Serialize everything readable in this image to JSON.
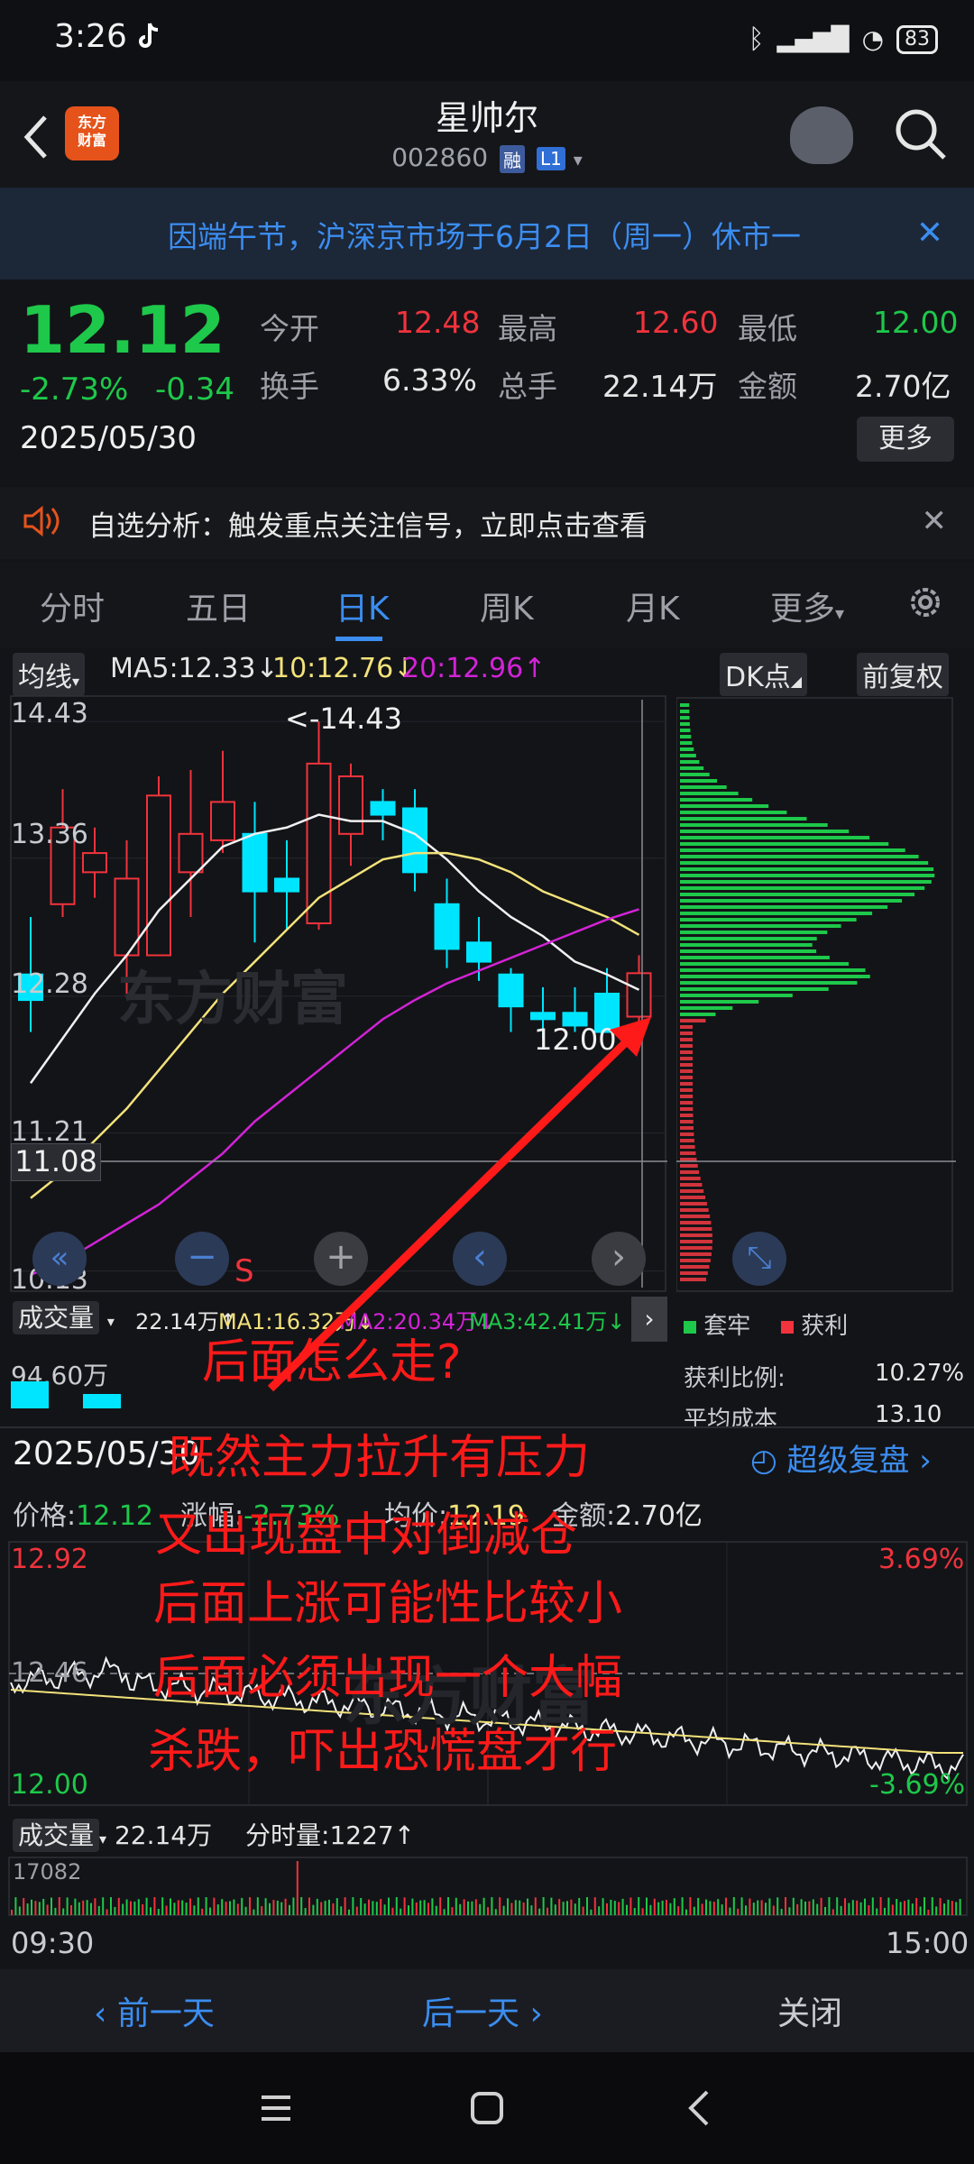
{
  "status_bar": {
    "time": "3:26",
    "battery": "83"
  },
  "header": {
    "name": "星帅尔",
    "code": "002860",
    "tags": [
      "融",
      "L1"
    ]
  },
  "banner": {
    "text": "因端午节，沪深京市场于6月2日（周一）休市一"
  },
  "quote": {
    "price": "12.12",
    "change_pct": "-2.73%",
    "change": "-0.34",
    "date": "2025/05/30",
    "open_label": "今开",
    "open": "12.48",
    "high_label": "最高",
    "high": "12.60",
    "low_label": "最低",
    "low": "12.00",
    "turnover_label": "换手",
    "turnover": "6.33%",
    "volume_label": "总手",
    "volume": "22.14万",
    "amount_label": "金额",
    "amount": "2.70亿",
    "more": "更多"
  },
  "notice": {
    "text": "自选分析：触发重点关注信号，立即点击查看"
  },
  "tabs": [
    "分时",
    "五日",
    "日K",
    "周K",
    "月K",
    "更多"
  ],
  "active_tab": 2,
  "kline": {
    "ma_selector": "均线",
    "ma5": "MA5:12.33",
    "ma10": "10:12.76",
    "ma20": "20:12.96",
    "dk": "DK点",
    "adjust": "前复权",
    "y_labels": [
      "14.43",
      "13.36",
      "12.28",
      "11.21",
      "10.13"
    ],
    "max_label": "<-14.43",
    "min_label": "12.00",
    "crosshair_label": "11.08",
    "s_marker": "S",
    "candles": [
      [
        12.45,
        12.25,
        12.9,
        12.0
      ],
      [
        13.0,
        13.6,
        13.9,
        12.9
      ],
      [
        13.25,
        13.4,
        13.6,
        13.05
      ],
      [
        12.6,
        13.2,
        13.5,
        12.3
      ],
      [
        12.6,
        13.85,
        14.0,
        12.6
      ],
      [
        13.25,
        13.55,
        14.05,
        12.9
      ],
      [
        13.5,
        13.8,
        14.2,
        13.4
      ],
      [
        13.55,
        13.1,
        13.8,
        12.7
      ],
      [
        13.2,
        13.1,
        13.5,
        12.8
      ],
      [
        12.85,
        14.1,
        14.43,
        12.8
      ],
      [
        13.55,
        14.0,
        14.1,
        13.3
      ],
      [
        13.8,
        13.7,
        13.9,
        13.5
      ],
      [
        13.75,
        13.25,
        13.9,
        13.1
      ],
      [
        13.0,
        12.65,
        13.2,
        12.5
      ],
      [
        12.7,
        12.55,
        12.9,
        12.4
      ],
      [
        12.45,
        12.2,
        12.5,
        12.0
      ],
      [
        12.15,
        12.1,
        12.35,
        11.95
      ],
      [
        12.15,
        12.05,
        12.35,
        12.0
      ],
      [
        12.3,
        12.0,
        12.5,
        12.0
      ],
      [
        12.12,
        12.46,
        12.6,
        12.0
      ]
    ],
    "ma5_line": [
      11.6,
      11.95,
      12.3,
      12.6,
      12.95,
      13.2,
      13.45,
      13.55,
      13.6,
      13.7,
      13.65,
      13.65,
      13.55,
      13.35,
      13.1,
      12.9,
      12.75,
      12.55,
      12.45,
      12.33
    ],
    "ma10_line": [
      10.7,
      10.9,
      11.15,
      11.4,
      11.7,
      12.0,
      12.3,
      12.55,
      12.8,
      13.05,
      13.2,
      13.35,
      13.4,
      13.4,
      13.35,
      13.25,
      13.1,
      13.0,
      12.9,
      12.76
    ],
    "ma20_line": [
      10.1,
      10.2,
      10.35,
      10.5,
      10.65,
      10.85,
      11.05,
      11.3,
      11.5,
      11.7,
      11.9,
      12.1,
      12.25,
      12.38,
      12.48,
      12.58,
      12.68,
      12.78,
      12.88,
      12.96
    ],
    "controls": [
      "«",
      "−",
      "+",
      "‹",
      "›",
      "⤡"
    ]
  },
  "chip": {
    "legend1": "套牢",
    "legend2": "获利",
    "ratio_label": "获利比例:",
    "ratio": "10.27%",
    "avg_label": "平均成本",
    "avg": "13.10"
  },
  "vol_bar": {
    "label": "成交量",
    "vol": "22.14万",
    "ma1": "MA1:16.32万",
    "ma2": "MA2:20.34万",
    "ma3": "MA3:42.41万",
    "y": "94.60万"
  },
  "annotations": [
    "后面怎么走?",
    "既然主力拉升有压力",
    "又出现盘中对倒减仓",
    "后面上涨可能性比较小",
    "后面必须出现一个大幅",
    "杀跌，吓出恐慌盘才行"
  ],
  "replay": {
    "date": "2025/05/30",
    "link": "超级复盘"
  },
  "intraday": {
    "price_label": "价格:",
    "price": "12.12",
    "change_label": "涨幅:",
    "change": "-2.73%",
    "avg_label": "均价:",
    "avg": "12.19",
    "amount_label": "金额:",
    "amount": "2.70亿",
    "hi": "12.92",
    "mid": "12.46",
    "lo": "12.00",
    "hi_pct": "3.69%",
    "lo_pct": "-3.69%",
    "vol_label": "成交量",
    "vol": "22.14万",
    "tick_label": "分时量:",
    "tick": "1227",
    "vol_max": "17082",
    "start": "09:30",
    "end": "15:00"
  },
  "bottom_nav": {
    "prev": "前一天",
    "next": "后一天",
    "close": "关闭"
  },
  "colors": {
    "up": "#f0333c",
    "down": "#00e5ff",
    "accent": "#3b8df0",
    "green": "#1ec84a"
  }
}
